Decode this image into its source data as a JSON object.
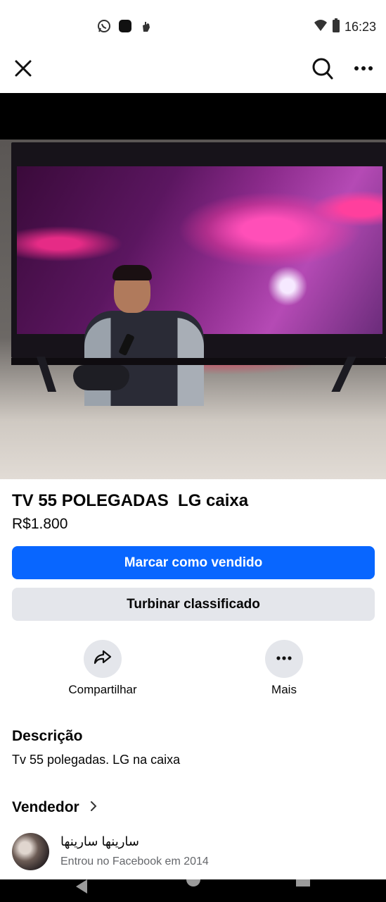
{
  "status_bar": {
    "time": "16:23",
    "left_icons": [
      "whatsapp-icon",
      "app-square-icon",
      "gesture-hand-icon"
    ],
    "right_icons": [
      "wifi-icon",
      "battery-icon"
    ]
  },
  "top_nav": {
    "icons": [
      "close-icon",
      "search-icon",
      "more-icon"
    ]
  },
  "listing": {
    "title": "TV 55 POLEGADAS  LG caixa",
    "price": "R$1.800"
  },
  "buttons": {
    "mark_sold": "Marcar como vendido",
    "boost": "Turbinar classificado"
  },
  "actions": {
    "share": "Compartilhar",
    "more": "Mais"
  },
  "description": {
    "heading": "Descrição",
    "text": "Tv 55 polegadas. LG na caixa"
  },
  "seller": {
    "heading": "Vendedor",
    "name": "سارينها سارينها",
    "joined": "Entrou no Facebook em 2014"
  },
  "colors": {
    "primary": "#0866ff",
    "secondary_bg": "#e4e6eb",
    "muted_text": "#65676b"
  }
}
